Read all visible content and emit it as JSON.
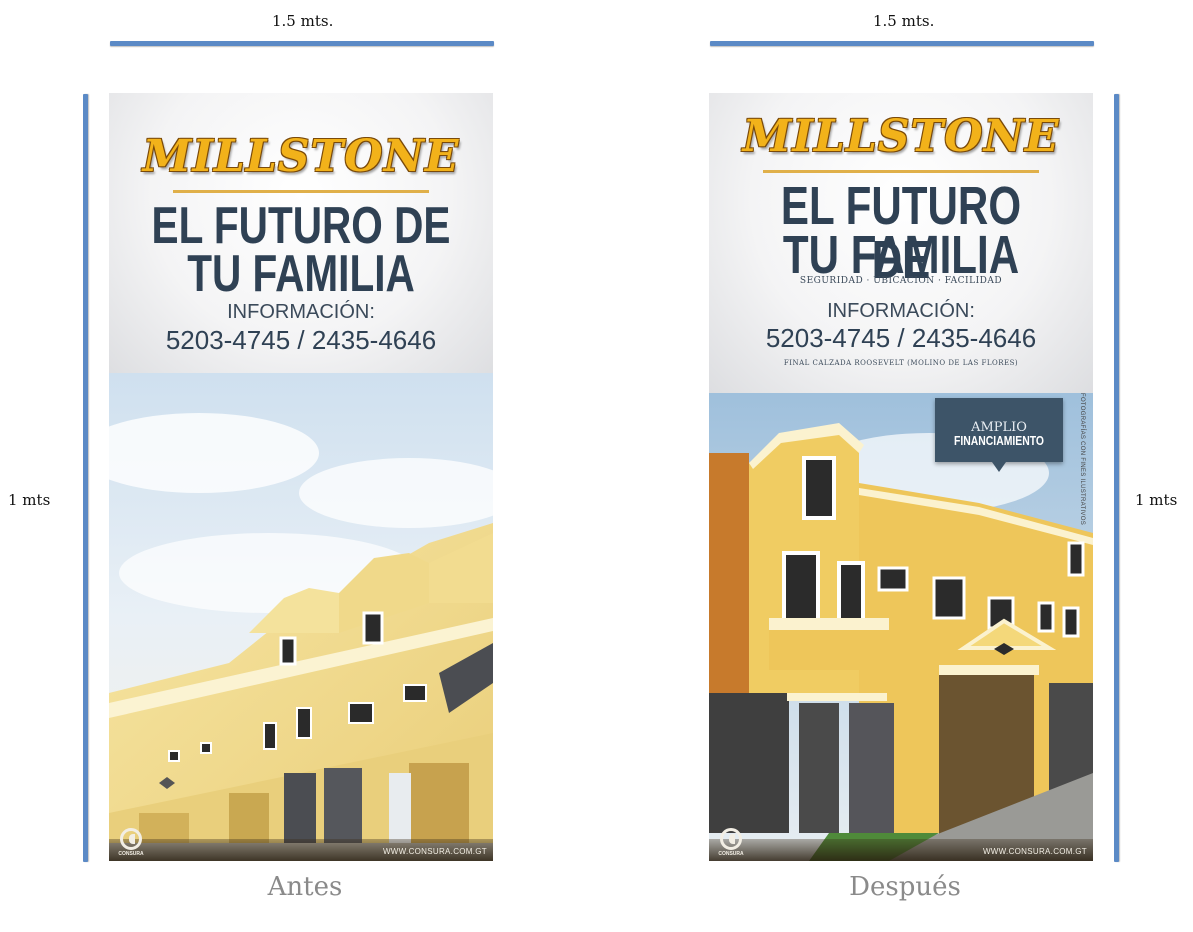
{
  "left": {
    "width_label": "1.5 mts.",
    "height_label": "1 mts",
    "caption": "Antes",
    "banner": {
      "logo": "MILLSTONE",
      "headline_1": "EL FUTURO DE",
      "headline_2": "TU FAMILIA",
      "info_label": "INFORMACIÓN:",
      "phones": "5203-4745 / 2435-4646",
      "footer_brand": "CONSURA",
      "footer_url": "WWW.CONSURA.COM.GT"
    }
  },
  "right": {
    "width_label": "1.5 mts.",
    "height_label": "1 mts",
    "caption": "Después",
    "banner": {
      "logo": "MILLSTONE",
      "headline_1": "EL FUTURO DE",
      "headline_2": "TU FAMILIA",
      "tagline": "SEGURIDAD · UBICACIÓN · FACILIDAD",
      "info_label": "INFORMACIÓN:",
      "phones": "5203-4745 / 2435-4646",
      "address": "FINAL CALZADA ROOSEVELT (MOLINO DE LAS FLORES)",
      "badge_line_1": "AMPLIO",
      "badge_line_2": "FINANCIAMIENTO",
      "side_credit": "FOTOGRAFÍAS CON FINES ILUSTRATIVOS",
      "footer_brand": "CONSURA",
      "footer_url": "WWW.CONSURA.COM.GT"
    }
  },
  "colors": {
    "measure_bar": "#5b8ac6",
    "headline": "#2f4154",
    "logo_gold": "#f2b21a",
    "badge": "#3d5468",
    "caption": "#8a8a8a"
  }
}
